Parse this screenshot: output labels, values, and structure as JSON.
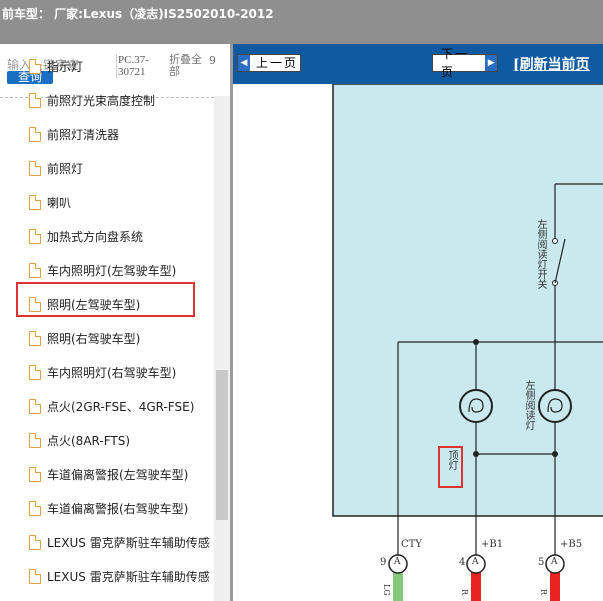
{
  "title": "前车型： 厂家:Lexus（凌志)IS2502010-2012",
  "search": {
    "keyword_placeholder": "输入关键字查",
    "query_button": "查询",
    "pc_code": "PC.37-30721",
    "collapse_label": "折叠全部",
    "collapse_extra": "9"
  },
  "tree": {
    "items": [
      {
        "label": "指示灯"
      },
      {
        "label": "前照灯光束高度控制"
      },
      {
        "label": "前照灯清洗器"
      },
      {
        "label": "前照灯"
      },
      {
        "label": "喇叭"
      },
      {
        "label": "加热式方向盘系统"
      },
      {
        "label": "车内照明灯(左驾驶车型)",
        "highlighted": true
      },
      {
        "label": "照明(左驾驶车型)"
      },
      {
        "label": "照明(右驾驶车型)"
      },
      {
        "label": "车内照明灯(右驾驶车型)"
      },
      {
        "label": "点火(2GR-FSE、4GR-FSE)"
      },
      {
        "label": "点火(8AR-FTS)"
      },
      {
        "label": "车道偏离警报(左驾驶车型)"
      },
      {
        "label": "车道偏离警报(右驾驶车型)"
      },
      {
        "label": "LEXUS 雷克萨斯驻车辅助传感"
      },
      {
        "label": "LEXUS 雷克萨斯驻车辅助传感"
      }
    ]
  },
  "nav": {
    "prev_label": "上一页",
    "next_label": "下一页",
    "refresh_label": "[刷新当前页"
  },
  "diagram": {
    "switch_label": "左侧阅读灯开关",
    "dome_label": "顶灯",
    "reading_lamp_label": "左侧阅读灯",
    "pins": [
      {
        "number": "9",
        "connector": "A",
        "signal": "CTY",
        "wire": "LG"
      },
      {
        "number": "4",
        "connector": "A",
        "signal": "+B1",
        "wire": "R"
      },
      {
        "number": "5",
        "connector": "A",
        "signal": "+B5",
        "wire": "R"
      }
    ],
    "colors": {
      "background": "#c9e9ef",
      "wire_green": "#86c97a",
      "wire_red": "#e8221e"
    }
  }
}
